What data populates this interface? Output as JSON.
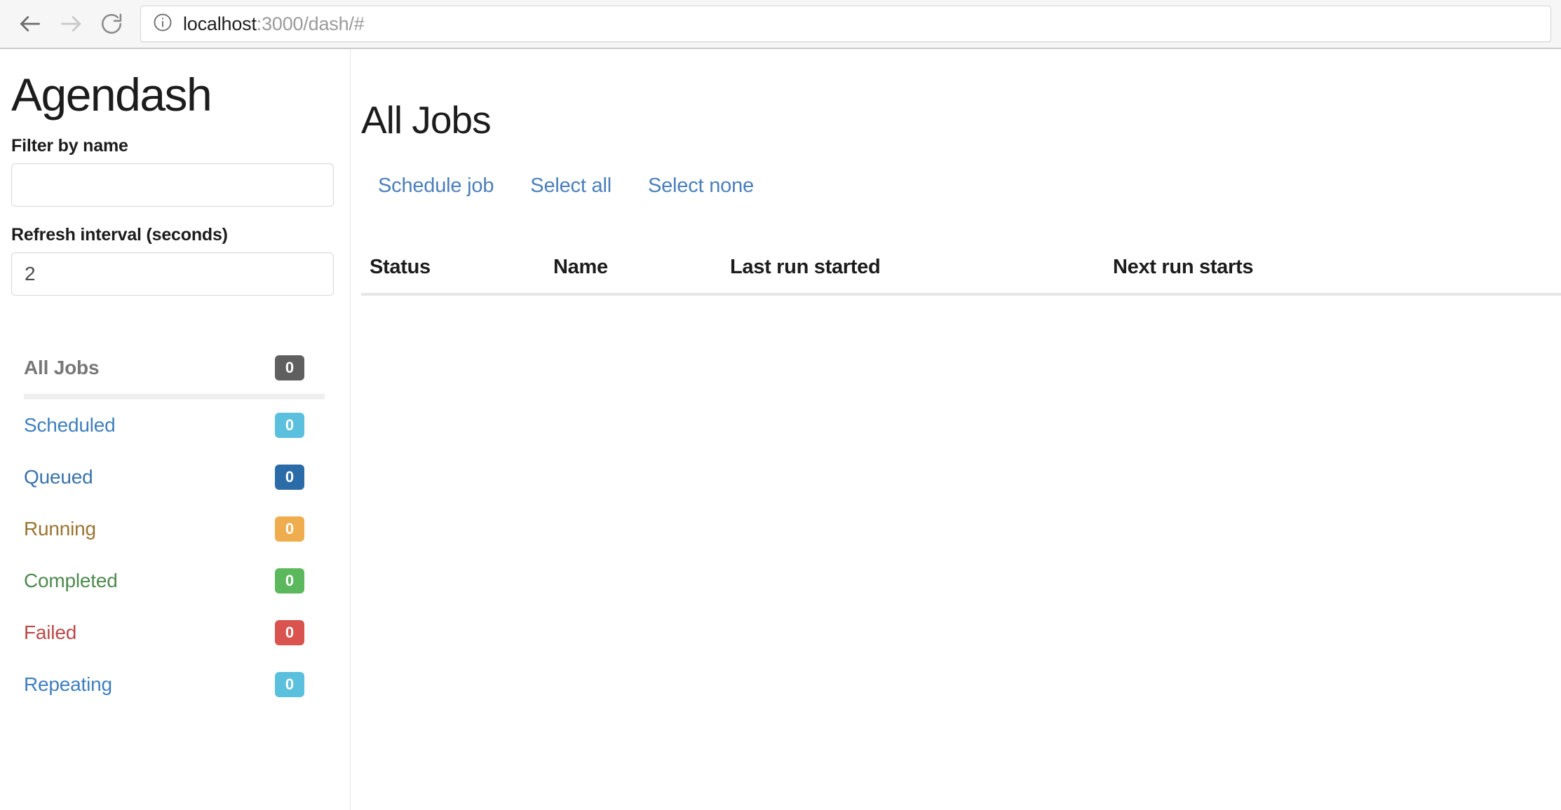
{
  "browser": {
    "back_icon": "arrow-left-icon",
    "forward_icon": "arrow-right-icon",
    "reload_icon": "reload-icon",
    "info_icon": "info-circle-icon",
    "url_host": "localhost",
    "url_rest": ":3000/dash/#"
  },
  "sidebar": {
    "title": "Agendash",
    "filter": {
      "label": "Filter by name",
      "value": "",
      "placeholder": ""
    },
    "refresh": {
      "label": "Refresh interval (seconds)",
      "value": "2",
      "placeholder": ""
    },
    "nav": [
      {
        "label": "All Jobs",
        "count": "0",
        "color": "#5f5f5f",
        "state": "active"
      },
      {
        "label": "Scheduled",
        "count": "0",
        "color": "#5bc0de",
        "state": "link"
      },
      {
        "label": "Queued",
        "count": "0",
        "color": "#2a6ba8",
        "state": "link"
      },
      {
        "label": "Running",
        "count": "0",
        "color": "#f0ad4e",
        "state": "link"
      },
      {
        "label": "Completed",
        "count": "0",
        "color": "#5cb85c",
        "state": "link"
      },
      {
        "label": "Failed",
        "count": "0",
        "color": "#d9534f",
        "state": "link"
      },
      {
        "label": "Repeating",
        "count": "0",
        "color": "#5bc0de",
        "state": "link"
      }
    ]
  },
  "main": {
    "title": "All Jobs",
    "actions": {
      "schedule_job": "Schedule job",
      "select_all": "Select all",
      "select_none": "Select none"
    },
    "table": {
      "columns": [
        "Status",
        "Name",
        "Last run started",
        "Next run starts"
      ],
      "rows": []
    }
  }
}
